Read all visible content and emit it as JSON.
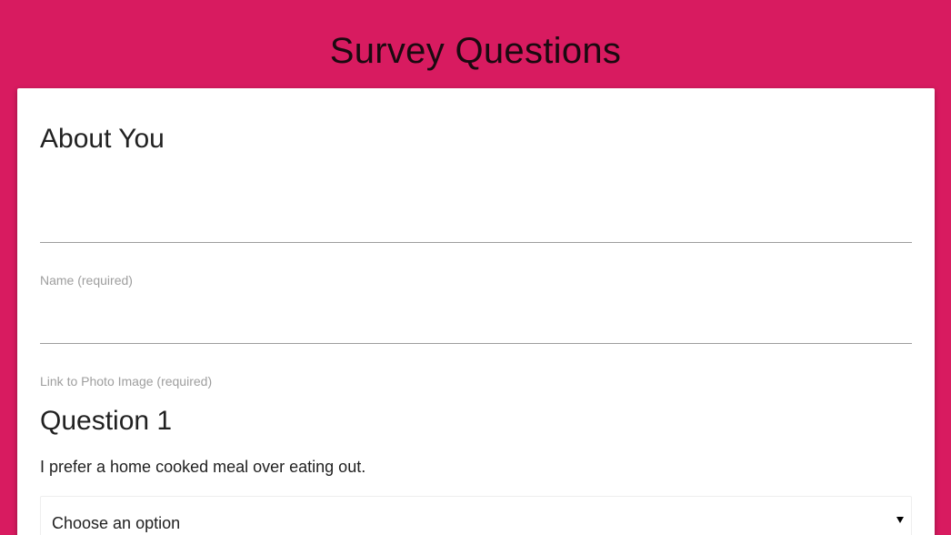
{
  "header": {
    "title": "Survey Questions"
  },
  "form": {
    "about_section": {
      "heading": "About You",
      "name_field": {
        "label": "Name (required)",
        "value": ""
      },
      "photo_field": {
        "label": "Link to Photo Image (required)",
        "value": ""
      }
    },
    "question_1": {
      "heading": "Question 1",
      "text": "I prefer a home cooked meal over eating out.",
      "select": {
        "selected": "Choose an option",
        "icon": "caret-down-icon"
      }
    }
  },
  "colors": {
    "background": "#d81b60",
    "card": "#ffffff",
    "title_text": "#1a0a10",
    "label_text": "#9e9e9e"
  }
}
